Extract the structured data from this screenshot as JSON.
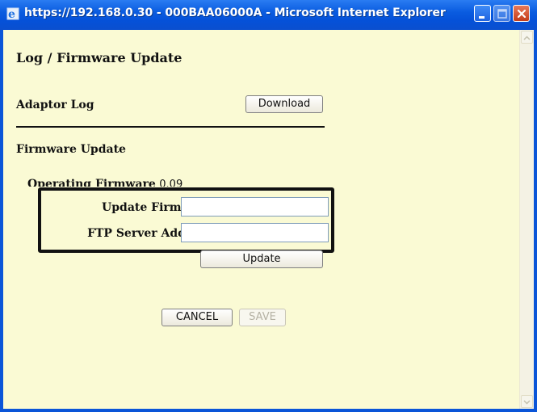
{
  "window": {
    "title": "https://192.168.0.30 - 000BAA06000A - Microsoft Internet Explorer",
    "icon": "ie-icon"
  },
  "page": {
    "heading": "Log / Firmware Update",
    "adaptor_log": {
      "label": "Adaptor Log",
      "download_label": "Download"
    },
    "firmware": {
      "section_label": "Firmware Update",
      "operating_label": "Operating Firmware",
      "operating_value": "0.09",
      "update_firmware_label": "Update Firmware",
      "update_firmware_value": "",
      "ftp_label": "FTP Server Address",
      "ftp_value": "",
      "update_label": "Update"
    },
    "actions": {
      "cancel_label": "CANCEL",
      "save_label": "SAVE"
    }
  },
  "colors": {
    "titlebar": "#0551d8",
    "page_background": "#fafad4",
    "callout_border": "#111111"
  }
}
